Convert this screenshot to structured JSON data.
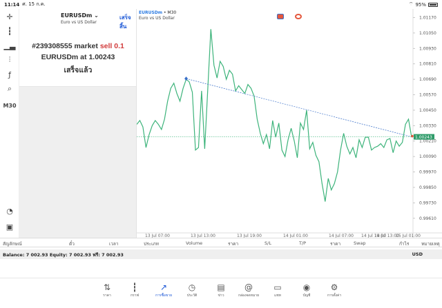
{
  "status": {
    "time": "11:14",
    "date": "ศ. 15 ก.ค.",
    "battery": "95%"
  },
  "toolbar": {
    "timeframe": "M30"
  },
  "order_panel": {
    "symbol": "EURUSDm",
    "description": "Euro vs US Dollar",
    "done_label": "เสร็จสิ้น",
    "message_order": "#239308555 market",
    "message_side": "sell 0.1",
    "message_at_prefix": "EURUSDm at",
    "message_price": "1.00243",
    "message_status": "เสร็จแล้ว"
  },
  "chart": {
    "symbol": "EURUSDm",
    "timeframe": "• M30",
    "description": "Euro vs US Dollar"
  },
  "chart_data": {
    "type": "line",
    "y_ticks": [
      "1.01170",
      "1.01050",
      "1.00930",
      "1.00810",
      "1.00690",
      "1.00570",
      "1.00450",
      "1.00330",
      "1.00210",
      "1.00090",
      "0.99970",
      "0.99850",
      "0.99730",
      "0.99610"
    ],
    "x_ticks": [
      "13 Jul 07:00",
      "13 Jul 13:00",
      "13 Jul 19:00",
      "14 Jul 01:00",
      "14 Jul 07:00",
      "14 Jul 13:00",
      "14 Jul 19:00",
      "15 Jul 01:00"
    ],
    "ylim": [
      0.9955,
      1.0121
    ],
    "current_price": "1.00243",
    "series": [
      {
        "values": [
          1.0034,
          1.0037,
          1.0032,
          1.0016,
          1.0026,
          1.0033,
          1.0037,
          1.0034,
          1.003,
          1.0038,
          1.0052,
          1.0062,
          1.0066,
          1.0058,
          1.0052,
          1.0062,
          1.0069,
          1.0067,
          1.0059,
          1.0014,
          1.0016,
          1.006,
          1.0015,
          1.0062,
          1.0108,
          1.008,
          1.007,
          1.0083,
          1.0079,
          1.0069,
          1.0076,
          1.0073,
          1.006,
          1.0064,
          1.0061,
          1.0058,
          1.0065,
          1.0062,
          1.0056,
          1.0038,
          1.0027,
          1.0019,
          1.0026,
          1.0015,
          1.0037,
          1.0024,
          1.0035,
          1.0014,
          1.0009,
          1.0022,
          1.0031,
          1.0021,
          1.0008,
          1.0035,
          1.003,
          1.0045,
          1.0015,
          1.002,
          1.001,
          1.0005,
          0.9988,
          0.9974,
          0.9992,
          0.9983,
          0.9988,
          0.9997,
          1.0014,
          1.0027,
          1.0017,
          1.0011,
          1.0016,
          1.0008,
          1.0022,
          1.0016,
          1.0024,
          1.0024,
          1.0014,
          1.0016,
          1.0017,
          1.0019,
          1.0016,
          1.0022,
          1.0023,
          1.0012,
          1.0021,
          1.0017,
          1.002,
          1.0034,
          1.0038,
          1.0024
        ]
      }
    ]
  },
  "tabs": [
    "สัญลักษณ์",
    "ตั๋ว",
    "เวลา",
    "ประเภท",
    "Volume",
    "ราคา",
    "S/L",
    "T/P",
    "ราคา",
    "Swap",
    "กำไร",
    "หมายเหตุ"
  ],
  "balance": {
    "text": "Balance: 7 002.93 Equity: 7 002.93 ฟรี: 7 002.93",
    "currency": "USD"
  },
  "nav": [
    {
      "label": "ราคา",
      "icon": "quotes-icon"
    },
    {
      "label": "กราฟ",
      "icon": "chart-icon"
    },
    {
      "label": "การซื้อขาย",
      "icon": "trade-icon"
    },
    {
      "label": "ประวัติ",
      "icon": "history-icon"
    },
    {
      "label": "ข่าว",
      "icon": "news-icon"
    },
    {
      "label": "กล่องจดหมาย",
      "icon": "mail-icon"
    },
    {
      "label": "แชท",
      "icon": "chat-icon"
    },
    {
      "label": "บัญชี",
      "icon": "account-icon"
    },
    {
      "label": "การตั้งค่า",
      "icon": "settings-icon"
    }
  ]
}
